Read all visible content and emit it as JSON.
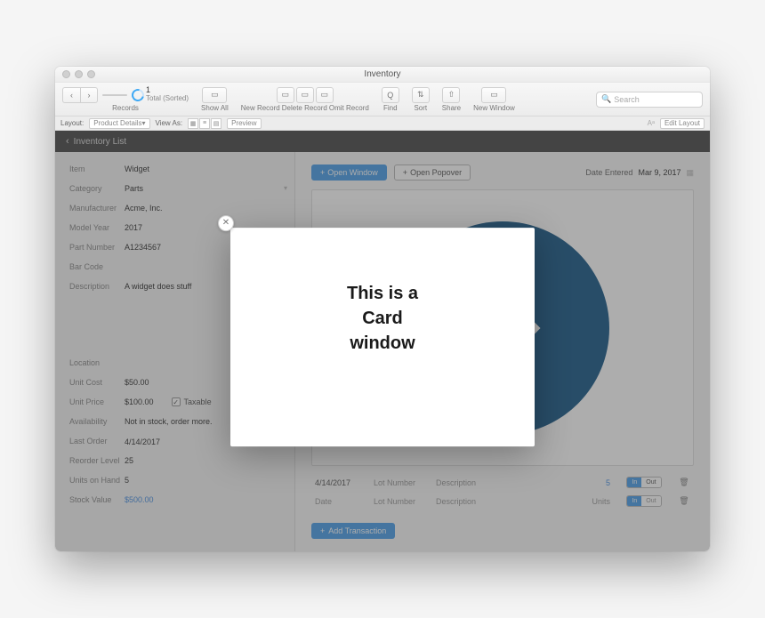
{
  "window_title": "Inventory",
  "toolbar": {
    "records_count": "1",
    "records_status": "Total (Sorted)",
    "records_label": "Records",
    "show_all": "Show All",
    "new_record": "New Record",
    "delete_record": "Delete Record",
    "omit_record": "Omit Record",
    "find": "Find",
    "sort": "Sort",
    "share": "Share",
    "new_window": "New Window",
    "search_placeholder": "Search"
  },
  "formatbar": {
    "layout_label": "Layout:",
    "layout_value": "Product Details",
    "view_as": "View As:",
    "preview": "Preview",
    "edit_layout": "Edit Layout"
  },
  "breadcrumb": "Inventory List",
  "fields": {
    "item": {
      "label": "Item",
      "value": "Widget"
    },
    "category": {
      "label": "Category",
      "value": "Parts"
    },
    "manufacturer": {
      "label": "Manufacturer",
      "value": "Acme, Inc."
    },
    "model_year": {
      "label": "Model Year",
      "value": "2017"
    },
    "part_number": {
      "label": "Part Number",
      "value": "A1234567"
    },
    "bar_code": {
      "label": "Bar Code",
      "value": ""
    },
    "description": {
      "label": "Description",
      "value": "A widget does stuff"
    },
    "location": {
      "label": "Location",
      "value": ""
    },
    "unit_cost": {
      "label": "Unit Cost",
      "value": "$50.00"
    },
    "unit_price": {
      "label": "Unit Price",
      "value": "$100.00"
    },
    "taxable_label": "Taxable",
    "availability": {
      "label": "Availability",
      "value": "Not in stock, order more."
    },
    "last_order": {
      "label": "Last Order",
      "value": "4/14/2017"
    },
    "reorder_level": {
      "label": "Reorder Level",
      "value": "25"
    },
    "units_on_hand": {
      "label": "Units on Hand",
      "value": "5"
    },
    "stock_value": {
      "label": "Stock Value",
      "value": "$500.00"
    }
  },
  "right_panel": {
    "open_window": "Open Window",
    "open_popover": "Open Popover",
    "date_entered_label": "Date Entered",
    "date_entered_value": "Mar 9, 2017",
    "add_transaction": "Add Transaction",
    "header": {
      "date": "Date",
      "lot": "Lot Number",
      "desc": "Description",
      "units": "Units"
    },
    "rows": [
      {
        "date": "4/14/2017",
        "lot": "Lot Number",
        "desc": "Description",
        "units": "5",
        "dir": "in"
      }
    ],
    "seg_in": "In",
    "seg_out": "Out"
  },
  "card": {
    "text": "This is a\nCard\nwindow"
  }
}
